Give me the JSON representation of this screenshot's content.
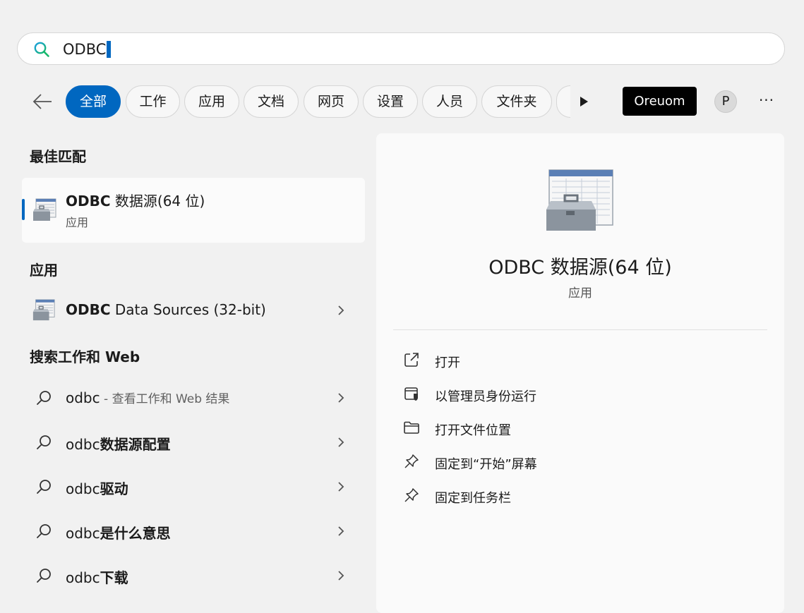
{
  "search": {
    "query": "ODBC"
  },
  "filters": {
    "items": [
      "全部",
      "工作",
      "应用",
      "文档",
      "网页",
      "设置",
      "人员",
      "文件夹"
    ],
    "account_label": "Oreuom",
    "avatar_initial": "P",
    "more_label": "···"
  },
  "best_match": {
    "heading": "最佳匹配",
    "title_bold": "ODBC",
    "title_rest": " 数据源(64 位)",
    "subtitle": "应用"
  },
  "apps": {
    "heading": "应用",
    "items": [
      {
        "bold": "ODBC",
        "rest": " Data Sources (32-bit)"
      }
    ]
  },
  "web": {
    "heading": "搜索工作和 Web",
    "items": [
      {
        "text": "odbc",
        "suffix": " - 查看工作和 Web 结果",
        "bold_rest": ""
      },
      {
        "text": "odbc",
        "bold_rest": "数据源配置",
        "suffix": ""
      },
      {
        "text": "odbc",
        "bold_rest": "驱动",
        "suffix": ""
      },
      {
        "text": "odbc",
        "bold_rest": "是什么意思",
        "suffix": ""
      },
      {
        "text": "odbc",
        "bold_rest": "下载",
        "suffix": ""
      }
    ]
  },
  "detail": {
    "title": "ODBC 数据源(64 位)",
    "subtitle": "应用",
    "actions": [
      {
        "label": "打开",
        "icon": "open-external-icon"
      },
      {
        "label": "以管理员身份运行",
        "icon": "admin-shield-icon"
      },
      {
        "label": "打开文件位置",
        "icon": "folder-icon"
      },
      {
        "label": "固定到“开始”屏幕",
        "icon": "pin-icon"
      },
      {
        "label": "固定到任务栏",
        "icon": "pin-icon"
      }
    ]
  },
  "colors": {
    "accent": "#0067c0",
    "background": "#f1f1f1",
    "panel": "#fafafa"
  }
}
